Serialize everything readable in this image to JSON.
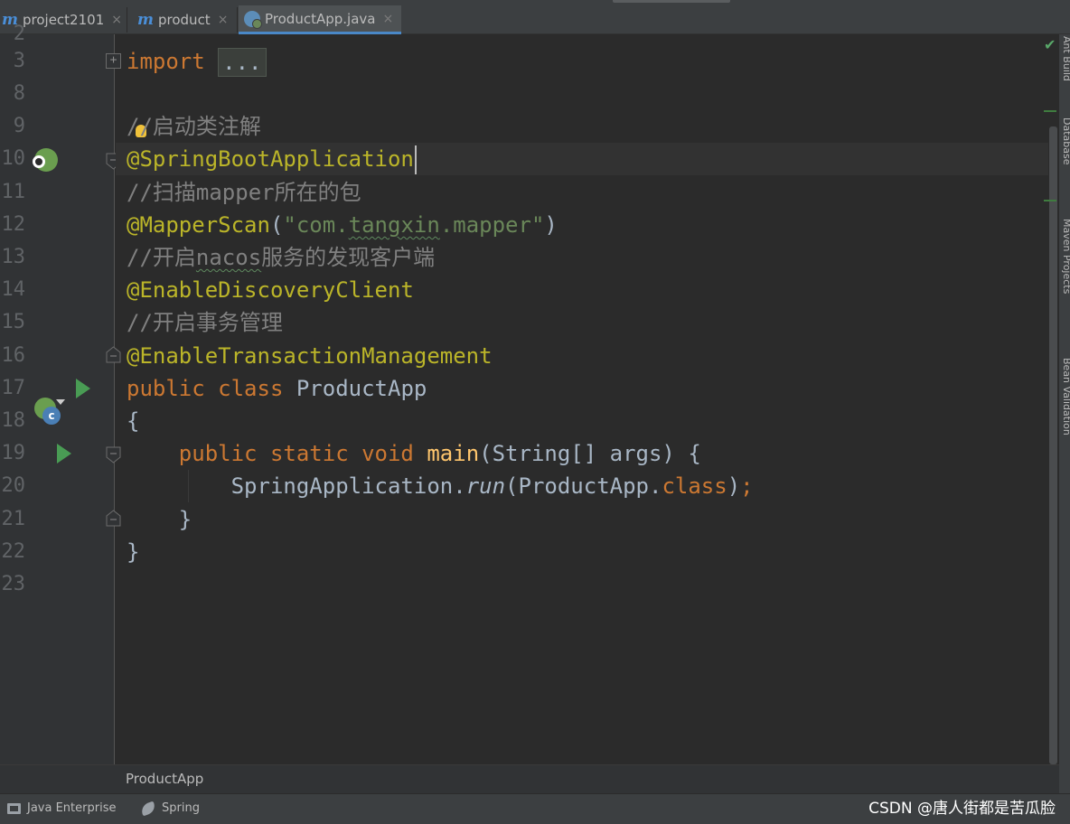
{
  "tabs": [
    {
      "icon": "m",
      "label": "project2101",
      "close": "×"
    },
    {
      "icon": "m",
      "label": "product",
      "close": "×"
    },
    {
      "icon": "spring-class-icon",
      "label": "ProductApp.java",
      "close": "×",
      "active": true
    }
  ],
  "editor": {
    "line_numbers": [
      "2",
      "3",
      "8",
      "9",
      "10",
      "11",
      "12",
      "13",
      "14",
      "15",
      "16",
      "17",
      "18",
      "19",
      "20",
      "21",
      "22",
      "23"
    ],
    "code": {
      "l3_kw": "import",
      "l3_fold": "...",
      "l9_comment_prefix": "/",
      "l9_comment_rest": "/启动类注解",
      "l10_ann": "@SpringBootApplication",
      "l11_cmt": "//扫描mapper所在的包",
      "l12_ann": "@MapperScan",
      "l12_open": "(",
      "l12_str_a": "\"com.",
      "l12_str_b": "tangxin",
      "l12_str_c": ".mapper\"",
      "l12_close": ")",
      "l13_cmt_a": "//开启",
      "l13_cmt_b": "nacos",
      "l13_cmt_c": "服务的发现客户端",
      "l14_ann": "@EnableDiscoveryClient",
      "l15_cmt": "//开启事务管理",
      "l16_ann": "@EnableTransactionManagement",
      "l17_kw": "public class ",
      "l17_name": "ProductApp",
      "l18": "{",
      "l19_kw": "public static void ",
      "l19_fn": "main",
      "l19_rest": "(String[] args) {",
      "l20_a": "SpringApplication.",
      "l20_run": "run",
      "l20_b": "(ProductApp.",
      "l20_kw": "class",
      "l20_c": ")",
      "l20_semi": ";",
      "l21": "}",
      "l22": "}"
    }
  },
  "right_tools": [
    "Ant Build",
    "Database",
    "Maven Projects",
    "Bean Validation"
  ],
  "breadcrumb": "ProductApp",
  "status": {
    "java_enterprise": "Java Enterprise",
    "spring": "Spring"
  },
  "watermark": "CSDN @唐人街都是苦瓜脸",
  "colors": {
    "background": "#2b2b2b",
    "keyword": "#cc7832",
    "annotation": "#bbb529",
    "comment": "#808080",
    "string": "#6a8759",
    "method": "#ffc66d"
  }
}
